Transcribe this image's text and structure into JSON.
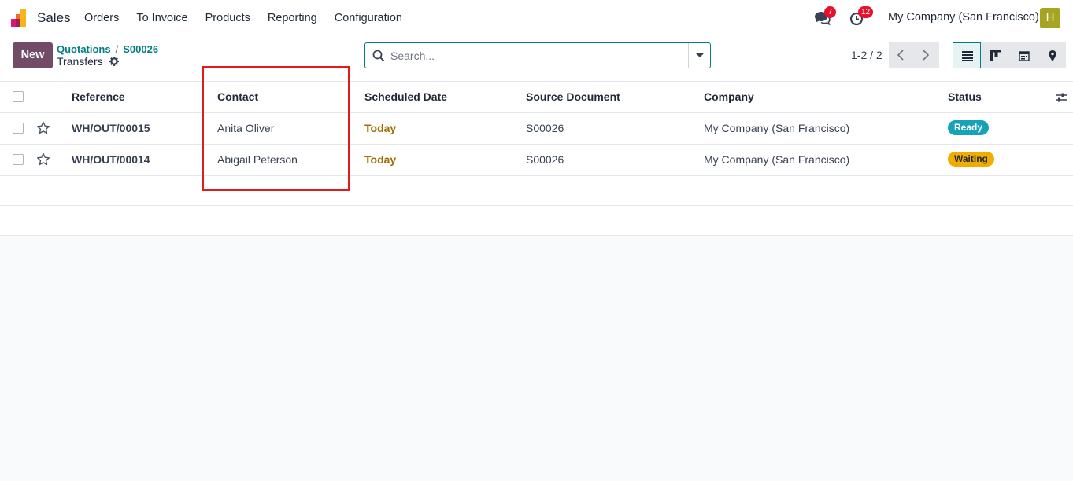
{
  "app": {
    "name": "Sales",
    "menu": [
      "Orders",
      "To Invoice",
      "Products",
      "Reporting",
      "Configuration"
    ]
  },
  "systray": {
    "messages_count": "7",
    "activities_count": "12",
    "company": "My Company (San Francisco)",
    "avatar_initial": "H"
  },
  "control_panel": {
    "new_label": "New",
    "breadcrumbs": [
      "Quotations",
      "S00026"
    ],
    "title": "Transfers",
    "search_placeholder": "Search...",
    "pager": "1-2 / 2"
  },
  "list": {
    "columns": [
      "Reference",
      "Contact",
      "Scheduled Date",
      "Source Document",
      "Company",
      "Status"
    ],
    "rows": [
      {
        "reference": "WH/OUT/00015",
        "contact": "Anita Oliver",
        "scheduled_date": "Today",
        "source_document": "S00026",
        "company": "My Company (San Francisco)",
        "status": "Ready"
      },
      {
        "reference": "WH/OUT/00014",
        "contact": "Abigail Peterson",
        "scheduled_date": "Today",
        "source_document": "S00026",
        "company": "My Company (San Francisco)",
        "status": "Waiting"
      }
    ]
  },
  "colors": {
    "brand": "#714b67",
    "accent": "#017e84",
    "status_ready": "#17a2b8",
    "status_waiting": "#f0ad00",
    "highlight": "#e01b1b"
  }
}
